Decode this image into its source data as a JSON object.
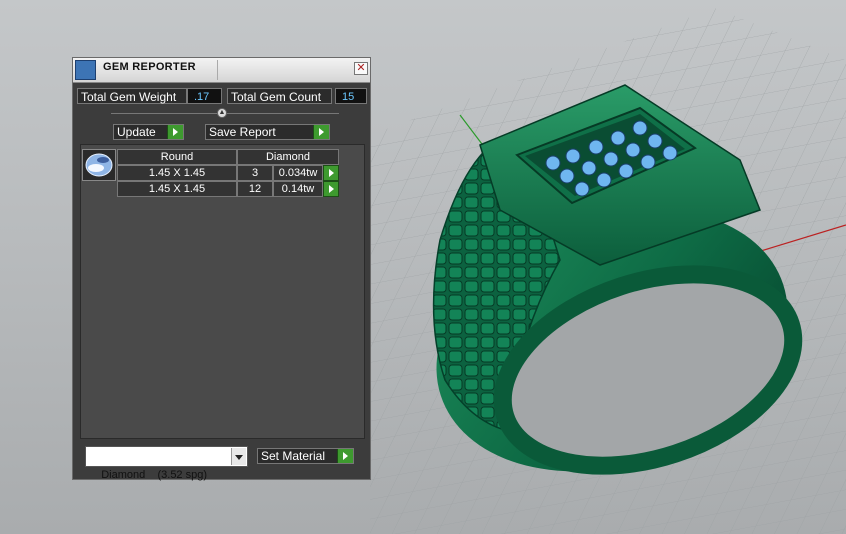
{
  "panel": {
    "title": "GEM REPORTER",
    "close_glyph": "✕",
    "total_weight_label": "Total Gem Weight",
    "total_weight_value": ".17",
    "total_count_label": "Total Gem Count",
    "total_count_value": "15",
    "update_label": "Update",
    "save_label": "Save Report",
    "table": {
      "headers": [
        "Round",
        "Diamond"
      ],
      "rows": [
        {
          "size": "1.45 X 1.45",
          "count": "3",
          "weight": "0.034tw"
        },
        {
          "size": "1.45 X 1.45",
          "count": "12",
          "weight": "0.14tw"
        }
      ]
    },
    "material_selected": "Diamond    (3.52 spg)",
    "set_material_label": "Set Material"
  },
  "icons": {
    "title": "gem-reporter-icon",
    "close": "close-icon",
    "collapse": "collapse-arrow-icon",
    "thumb": "round-gem-icon",
    "arrow": "green-arrow-icon",
    "chevron": "chevron-down-icon"
  },
  "colors": {
    "ring_green": "#0e6b45",
    "gem_blue": "#6fb6f0",
    "arrow_green": "#3e9a2f",
    "value_cyan": "#6cc8ff"
  }
}
